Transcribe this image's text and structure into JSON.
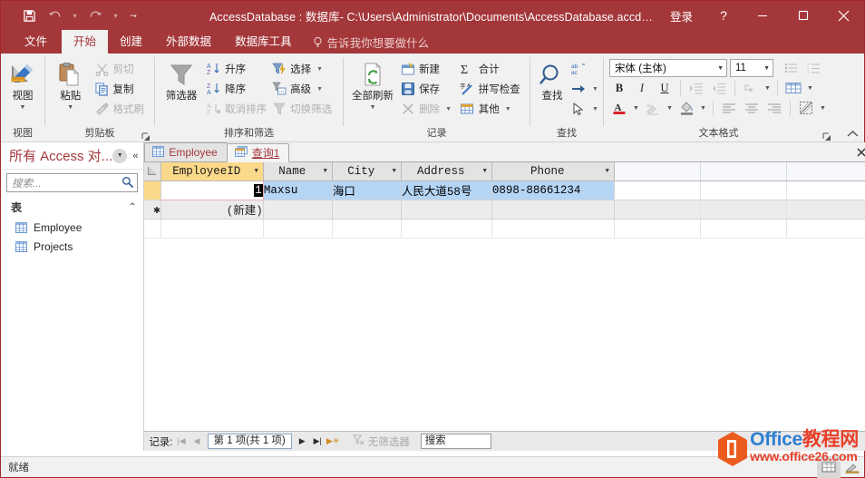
{
  "titlebar": {
    "title": "AccessDatabase : 数据库- C:\\Users\\Administrator\\Documents\\AccessDatabase.accdb (Access...",
    "signin": "登录",
    "help": "?",
    "qat": [
      {
        "name": "save-icon",
        "label": "保存"
      },
      {
        "name": "undo-icon",
        "label": "撤消"
      },
      {
        "name": "redo-icon",
        "label": "恢复"
      },
      {
        "name": "customize-qat-icon",
        "label": "自定义快速访问工具栏"
      }
    ],
    "window_buttons": [
      {
        "name": "minimize-button",
        "label": "最小化"
      },
      {
        "name": "maximize-button",
        "label": "最大化"
      },
      {
        "name": "close-button",
        "label": "关闭"
      }
    ]
  },
  "ribbon": {
    "tabs": [
      {
        "label": "文件",
        "active": false
      },
      {
        "label": "开始",
        "active": true
      },
      {
        "label": "创建",
        "active": false
      },
      {
        "label": "外部数据",
        "active": false
      },
      {
        "label": "数据库工具",
        "active": false
      }
    ],
    "tellme": "告诉我你想要做什么",
    "collapse_label": "折叠功能区",
    "groups": {
      "view": {
        "label": "视图",
        "button": "视图"
      },
      "clipboard": {
        "label": "剪贴板",
        "paste": "粘贴",
        "items": [
          {
            "label": "剪切",
            "icon": "scissors-icon",
            "disabled": true
          },
          {
            "label": "复制",
            "icon": "copy-icon",
            "disabled": false
          },
          {
            "label": "格式刷",
            "icon": "format-painter-icon",
            "disabled": true
          }
        ]
      },
      "sort_filter": {
        "label": "排序和筛选",
        "filter": "筛选器",
        "items": [
          {
            "label": "升序",
            "icon": "sort-asc-icon",
            "disabled": false
          },
          {
            "label": "降序",
            "icon": "sort-desc-icon",
            "disabled": false
          },
          {
            "label": "取消排序",
            "icon": "clear-sort-icon",
            "disabled": true
          },
          {
            "label": "选择",
            "icon": "selection-icon",
            "disabled": false,
            "dropdown": true
          },
          {
            "label": "高级",
            "icon": "advanced-filter-icon",
            "disabled": false,
            "dropdown": true
          },
          {
            "label": "切换筛选",
            "icon": "toggle-filter-icon",
            "disabled": true
          }
        ]
      },
      "records": {
        "label": "记录",
        "refresh_all": "全部刷新",
        "items": [
          {
            "label": "新建",
            "icon": "new-record-icon",
            "disabled": false
          },
          {
            "label": "保存",
            "icon": "save-record-icon",
            "disabled": false
          },
          {
            "label": "删除",
            "icon": "delete-record-icon",
            "disabled": true,
            "dropdown": true
          },
          {
            "label": "合计",
            "icon": "totals-icon",
            "disabled": false
          },
          {
            "label": "拼写检查",
            "icon": "spelling-icon",
            "disabled": false
          },
          {
            "label": "其他",
            "icon": "more-icon",
            "disabled": false,
            "dropdown": true
          }
        ]
      },
      "find": {
        "label": "查找",
        "find_button": "查找",
        "items": [
          {
            "label": "替换",
            "icon": "replace-icon"
          },
          {
            "label": "转至",
            "icon": "goto-icon"
          },
          {
            "label": "选择",
            "icon": "select-pointer-icon"
          }
        ]
      },
      "text_format": {
        "label": "文本格式",
        "font_name": "宋体 (主体)",
        "font_size": "11",
        "bold": "B",
        "italic": "I",
        "underline": "U",
        "font_color_letter": "A"
      }
    }
  },
  "navpane": {
    "title": "所有 Access 对...",
    "search_placeholder": "搜索...",
    "group_label": "表",
    "items": [
      {
        "label": "Employee",
        "icon": "table-icon"
      },
      {
        "label": "Projects",
        "icon": "table-icon"
      }
    ]
  },
  "document": {
    "tabs": [
      {
        "label": "Employee",
        "icon": "table-icon",
        "active": false
      },
      {
        "label": "查询1",
        "icon": "query-icon",
        "active": true
      }
    ],
    "close_label": "×"
  },
  "datasheet": {
    "columns": [
      "EmployeeID",
      "Name",
      "City",
      "Address",
      "Phone"
    ],
    "rows": [
      {
        "EmployeeID": "1",
        "Name": "Maxsu",
        "City": "海口",
        "Address": "人民大道58号",
        "Phone": "0898-88661234"
      }
    ],
    "new_row_label": "(新建)",
    "new_row_marker": "✱"
  },
  "recordnav": {
    "label": "记录:",
    "position": "第 1 项(共 1 项)",
    "filter_label": "无筛选器",
    "search_value": "搜索"
  },
  "statusbar": {
    "text": "就绪",
    "views": [
      {
        "name": "datasheet-view-button",
        "label": "数据表视图",
        "active": true
      },
      {
        "name": "design-view-button",
        "label": "设计视图",
        "active": false
      }
    ]
  },
  "watermark": {
    "line1_en": "Office",
    "line1_cn": "教程网",
    "line2": "www.office26.com"
  },
  "colors": {
    "accent": "#a4373a",
    "selection": "#b5d5f5",
    "header_selected": "#fbd98b",
    "ribbon_bg": "#f1f1f1"
  }
}
